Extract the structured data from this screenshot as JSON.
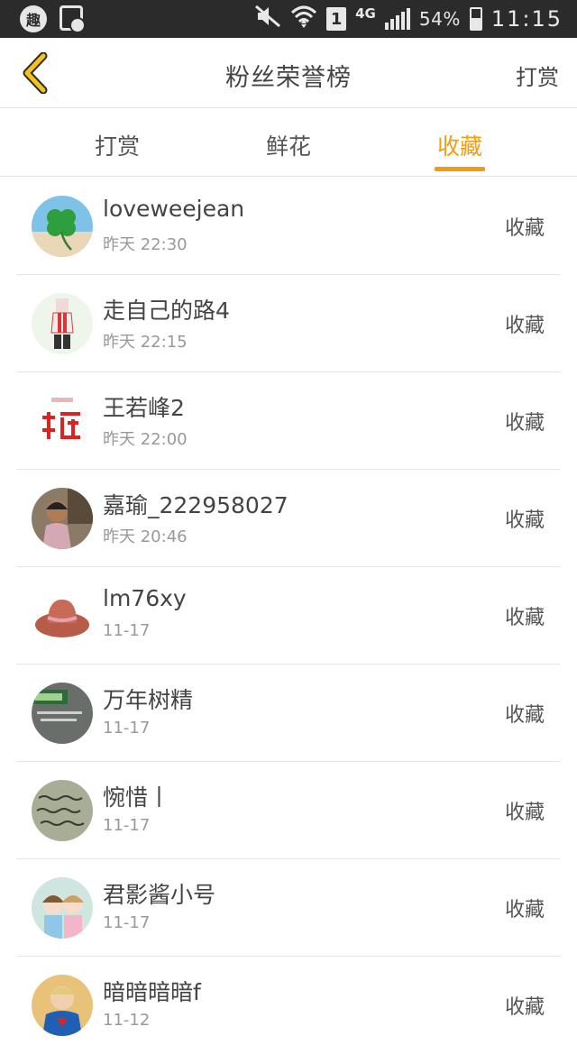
{
  "status_bar": {
    "app_badge": "趣",
    "sim": "1",
    "network": "4G",
    "battery": "54%",
    "time": "11:15"
  },
  "header": {
    "title": "粉丝荣誉榜",
    "action": "打赏"
  },
  "tabs": [
    {
      "label": "打赏",
      "active": false
    },
    {
      "label": "鲜花",
      "active": false
    },
    {
      "label": "收藏",
      "active": true
    }
  ],
  "colors": {
    "accent": "#f39c12",
    "text": "#444444",
    "subtext": "#999999",
    "statusbar": "#2b2b2b"
  },
  "list": [
    {
      "name": "loveweejean",
      "time": "昨天 22:30",
      "action": "收藏",
      "avatar": "clover-avatar"
    },
    {
      "name": "走自己的路4",
      "time": "昨天 22:15",
      "action": "收藏",
      "avatar": "girl-drawing-avatar"
    },
    {
      "name": "王若峰2",
      "time": "昨天 22:00",
      "action": "收藏",
      "avatar": "calligraphy-avatar"
    },
    {
      "name": "嘉瑜_222958027",
      "time": "昨天 20:46",
      "action": "收藏",
      "avatar": "child-photo-avatar"
    },
    {
      "name": "lm76xy",
      "time": "11-17",
      "action": "收藏",
      "avatar": "cowboy-hat-avatar"
    },
    {
      "name": "万年树精",
      "time": "11-17",
      "action": "收藏",
      "avatar": "sign-photo-avatar"
    },
    {
      "name": "惋惜丨",
      "time": "11-17",
      "action": "收藏",
      "avatar": "handwriting-avatar"
    },
    {
      "name": "君影酱小号",
      "time": "11-17",
      "action": "收藏",
      "avatar": "anime-girls-avatar"
    },
    {
      "name": "暗暗暗暗f",
      "time": "11-12",
      "action": "收藏",
      "avatar": "kid-superman-avatar"
    }
  ]
}
